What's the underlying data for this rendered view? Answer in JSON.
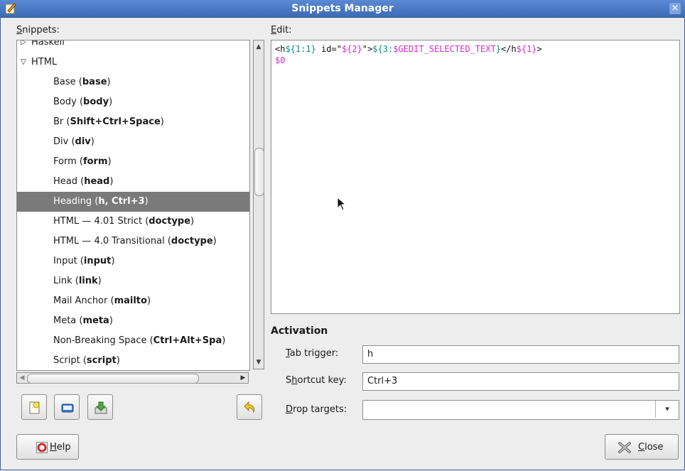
{
  "window": {
    "title": "Snippets Manager"
  },
  "snippets_label": {
    "mnemonic": "S",
    "rest": "nippets:"
  },
  "edit_label": {
    "mnemonic": "E",
    "rest": "dit:"
  },
  "tree": [
    {
      "kind": "group",
      "expanded": false,
      "label": "Haskell"
    },
    {
      "kind": "group",
      "expanded": true,
      "label": "HTML"
    },
    {
      "kind": "item",
      "name": "Base",
      "trigger": "base"
    },
    {
      "kind": "item",
      "name": "Body",
      "trigger": "body"
    },
    {
      "kind": "item",
      "name": "Br",
      "trigger": "Shift+Ctrl+Space"
    },
    {
      "kind": "item",
      "name": "Div",
      "trigger": "div"
    },
    {
      "kind": "item",
      "name": "Form",
      "trigger": "form"
    },
    {
      "kind": "item",
      "name": "Head",
      "trigger": "head"
    },
    {
      "kind": "item",
      "name": "Heading",
      "trigger": "h, Ctrl+3",
      "selected": true
    },
    {
      "kind": "item",
      "name": "HTML — 4.01 Strict",
      "trigger": "doctype"
    },
    {
      "kind": "item",
      "name": "HTML — 4.0 Transitional",
      "trigger": "doctype"
    },
    {
      "kind": "item",
      "name": "Input",
      "trigger": "input"
    },
    {
      "kind": "item",
      "name": "Link",
      "trigger": "link"
    },
    {
      "kind": "item",
      "name": "Mail Anchor",
      "trigger": "mailto"
    },
    {
      "kind": "item",
      "name": "Meta",
      "trigger": "meta"
    },
    {
      "kind": "item",
      "name": "Non-Breaking Space",
      "trigger": "Ctrl+Alt+Spa"
    },
    {
      "kind": "item",
      "name": "Script",
      "trigger": "script"
    }
  ],
  "editor": {
    "line1": [
      {
        "t": "<h",
        "c": "blk"
      },
      {
        "t": "${1:1}",
        "c": "teal"
      },
      {
        "t": " id=\"",
        "c": "blk"
      },
      {
        "t": "${2}",
        "c": "mag"
      },
      {
        "t": "\">",
        "c": "blk"
      },
      {
        "t": "${3:",
        "c": "teal"
      },
      {
        "t": "$GEDIT_SELECTED_TEXT",
        "c": "mag"
      },
      {
        "t": "}",
        "c": "teal"
      },
      {
        "t": "</h",
        "c": "blk"
      },
      {
        "t": "${1}",
        "c": "mag"
      },
      {
        "t": ">",
        "c": "blk"
      }
    ],
    "line2": "$0"
  },
  "activation": {
    "heading": "Activation",
    "tab_trigger": {
      "mnemonic": "T",
      "rest": "ab trigger:",
      "value": "h"
    },
    "shortcut_key": {
      "before": "S",
      "mnemonic": "h",
      "rest": "ortcut key:",
      "value": "Ctrl+3"
    },
    "drop_targets": {
      "mnemonic": "D",
      "rest": "rop targets:",
      "value": ""
    }
  },
  "help_button": {
    "mnemonic": "H",
    "rest": "elp"
  },
  "close_button": {
    "mnemonic": "C",
    "rest": "lose"
  },
  "colors": {
    "titlebar": "#3c6bb5",
    "selection": "#7a7a7a",
    "snippet_var_teal": "#0a8a8a",
    "snippet_var_magenta": "#d12ad1"
  }
}
